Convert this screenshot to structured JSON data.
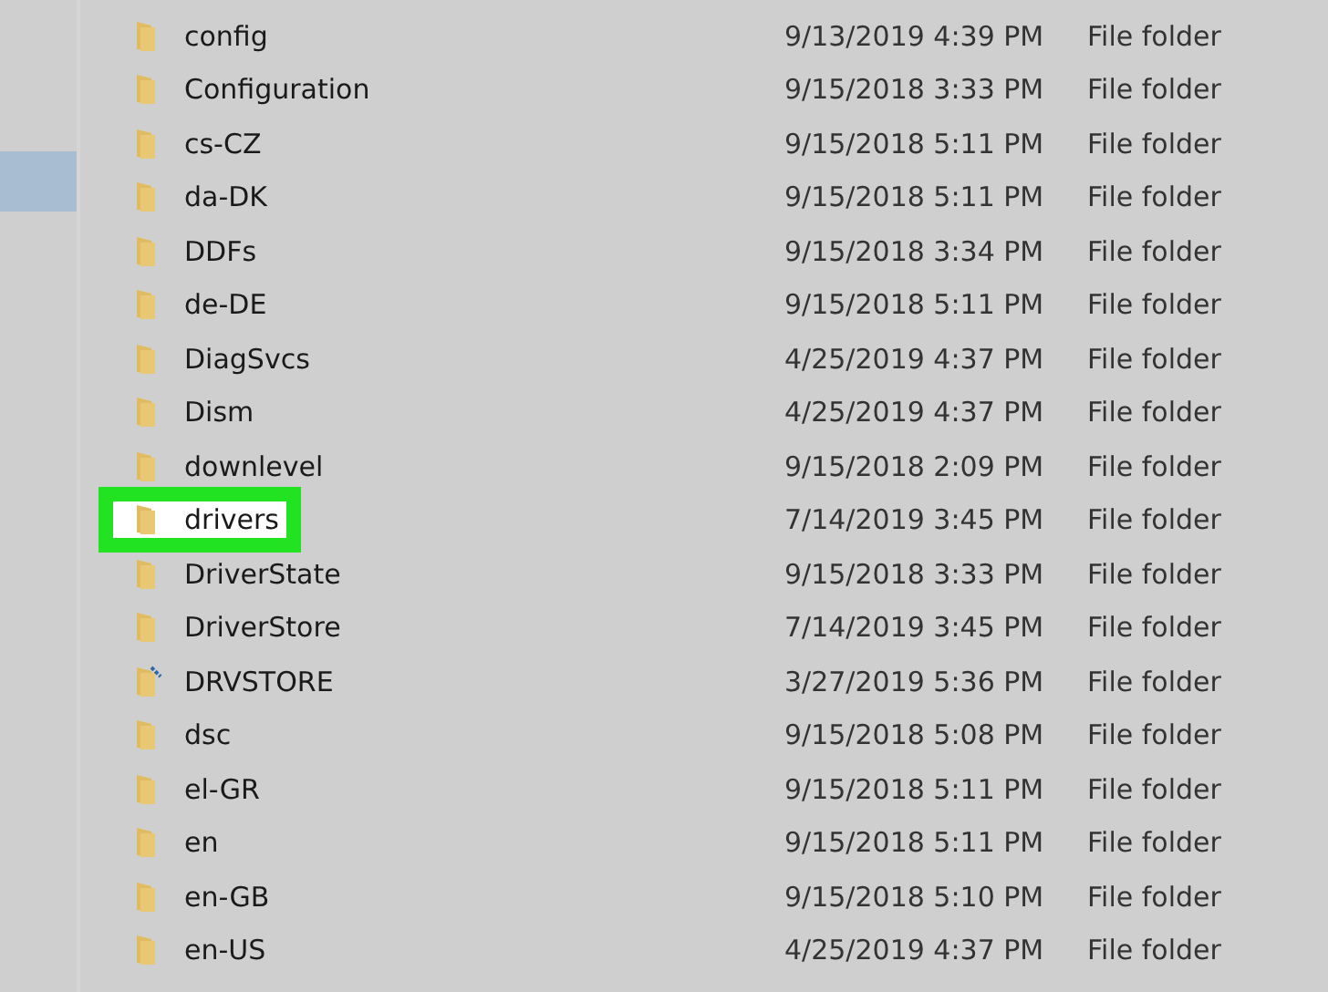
{
  "navigation_pane": {
    "items": [
      {
        "selected": true
      }
    ]
  },
  "files": [
    {
      "name": "config",
      "date_modified": "9/13/2019 4:39 PM",
      "type": "File folder",
      "kind": "folder",
      "highlighted": false
    },
    {
      "name": "Configuration",
      "date_modified": "9/15/2018 3:33 PM",
      "type": "File folder",
      "kind": "folder",
      "highlighted": false
    },
    {
      "name": "cs-CZ",
      "date_modified": "9/15/2018 5:11 PM",
      "type": "File folder",
      "kind": "folder",
      "highlighted": false
    },
    {
      "name": "da-DK",
      "date_modified": "9/15/2018 5:11 PM",
      "type": "File folder",
      "kind": "folder",
      "highlighted": false
    },
    {
      "name": "DDFs",
      "date_modified": "9/15/2018 3:34 PM",
      "type": "File folder",
      "kind": "folder",
      "highlighted": false
    },
    {
      "name": "de-DE",
      "date_modified": "9/15/2018 5:11 PM",
      "type": "File folder",
      "kind": "folder",
      "highlighted": false
    },
    {
      "name": "DiagSvcs",
      "date_modified": "4/25/2019 4:37 PM",
      "type": "File folder",
      "kind": "folder",
      "highlighted": false
    },
    {
      "name": "Dism",
      "date_modified": "4/25/2019 4:37 PM",
      "type": "File folder",
      "kind": "folder",
      "highlighted": false
    },
    {
      "name": "downlevel",
      "date_modified": "9/15/2018 2:09 PM",
      "type": "File folder",
      "kind": "folder",
      "highlighted": false
    },
    {
      "name": "drivers",
      "date_modified": "7/14/2019 3:45 PM",
      "type": "File folder",
      "kind": "folder",
      "highlighted": true
    },
    {
      "name": "DriverState",
      "date_modified": "9/15/2018 3:33 PM",
      "type": "File folder",
      "kind": "folder",
      "highlighted": false
    },
    {
      "name": "DriverStore",
      "date_modified": "7/14/2019 3:45 PM",
      "type": "File folder",
      "kind": "folder",
      "highlighted": false
    },
    {
      "name": "DRVSTORE",
      "date_modified": "3/27/2019 5:36 PM",
      "type": "File folder",
      "kind": "compressed-folder",
      "highlighted": false
    },
    {
      "name": "dsc",
      "date_modified": "9/15/2018 5:08 PM",
      "type": "File folder",
      "kind": "folder",
      "highlighted": false
    },
    {
      "name": "el-GR",
      "date_modified": "9/15/2018 5:11 PM",
      "type": "File folder",
      "kind": "folder",
      "highlighted": false
    },
    {
      "name": "en",
      "date_modified": "9/15/2018 5:11 PM",
      "type": "File folder",
      "kind": "folder",
      "highlighted": false
    },
    {
      "name": "en-GB",
      "date_modified": "9/15/2018 5:10 PM",
      "type": "File folder",
      "kind": "folder",
      "highlighted": false
    },
    {
      "name": "en-US",
      "date_modified": "4/25/2019 4:37 PM",
      "type": "File folder",
      "kind": "folder",
      "highlighted": false
    }
  ]
}
